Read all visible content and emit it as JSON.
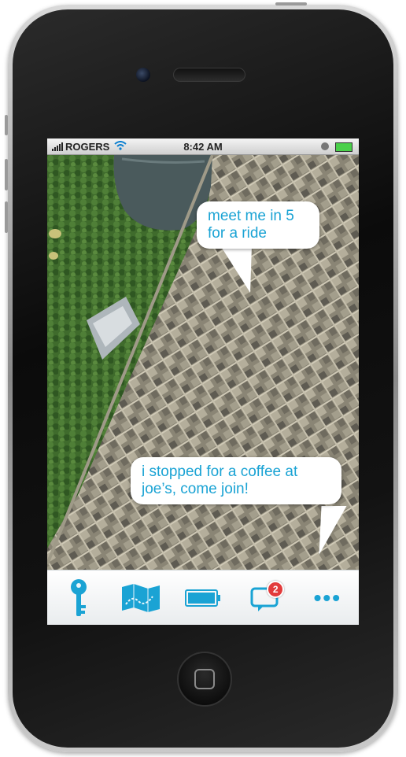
{
  "statusbar": {
    "carrier": "ROGERS",
    "time": "8:42 AM",
    "signal_icon": "signal-bars-icon",
    "wifi_icon": "wifi-icon",
    "lock_icon": "rotation-lock-icon",
    "battery_icon": "battery-charging-icon"
  },
  "map": {
    "bubbles": [
      {
        "text": "meet me in 5 for a ride"
      },
      {
        "text": "i stopped for a coffee at joe’s, come join!"
      }
    ]
  },
  "toolbar": {
    "items": [
      {
        "icon": "key-icon"
      },
      {
        "icon": "map-icon"
      },
      {
        "icon": "battery-icon"
      },
      {
        "icon": "chat-icon",
        "badge": "2"
      },
      {
        "icon": "more-icon",
        "label": "•••"
      }
    ]
  },
  "colors": {
    "accent": "#1aa3d4",
    "badge": "#e23b3b"
  }
}
